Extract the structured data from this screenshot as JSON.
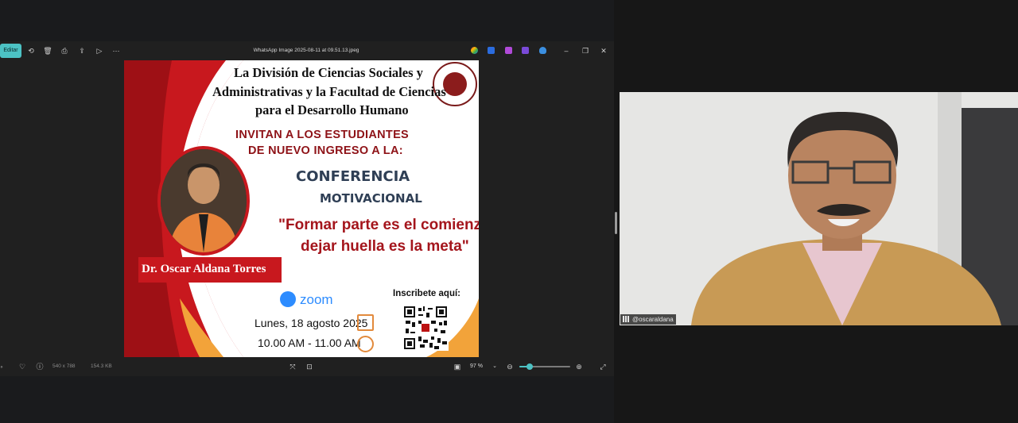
{
  "viewer": {
    "edit_label": "Editar",
    "file_title": "WhatsApp Image 2025-08-11 at 09.51.13.jpeg",
    "dimensions_label": "540 x 788",
    "filesize_label": "154.3 KB",
    "zoom_level": "97 %",
    "zoom_fraction": 0.2,
    "accent_color": "#4cc2c4",
    "icons": [
      "rotate-icon",
      "delete-icon",
      "print-icon",
      "share-icon",
      "slideshow-icon",
      "more-icon",
      "minimize-icon",
      "maximize-icon",
      "close-icon",
      "favorite-icon",
      "info-icon",
      "fit-icon",
      "actual-size-icon",
      "zoom-out-icon",
      "zoom-in-icon",
      "fullscreen-icon"
    ]
  },
  "poster": {
    "header_lines": [
      "La División de Ciencias Sociales y",
      "Administrativas  y la  Facultad de Ciencias",
      "para el Desarrollo Humano"
    ],
    "invite_lines": [
      "INVITAN A LOS ESTUDIANTES",
      "DE NUEVO INGRESO A LA:"
    ],
    "conference_lines": [
      "CONFERENCIA",
      "MOTIVACIONAL"
    ],
    "quote_lines": [
      "\"Formar parte es el comienzo,",
      "dejar huella es la meta\""
    ],
    "speaker_name": "Dr. Oscar Aldana Torres",
    "platform": "zoom",
    "date": "Lunes, 18 agosto 2025",
    "time": "10.00 AM - 11.00 AM",
    "signup_label": "Inscribete aquí:",
    "brand_red": "#c8181e",
    "accent_orange": "#f2a33a"
  },
  "participant": {
    "name": "@oscaraldana"
  }
}
